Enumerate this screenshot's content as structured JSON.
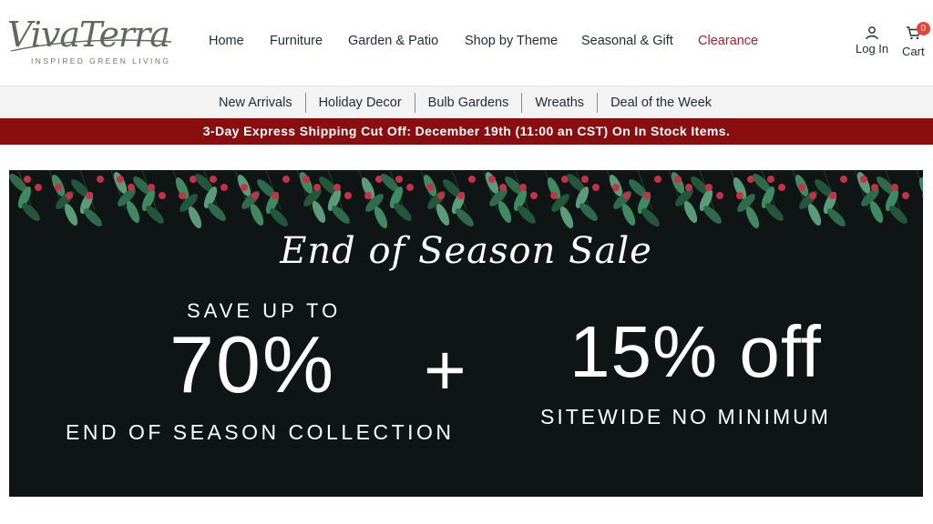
{
  "logo": {
    "wordmark": "VivaTerra",
    "tagline": "INSPIRED GREEN LIVING"
  },
  "main_nav": [
    {
      "label": "Home"
    },
    {
      "label": "Furniture"
    },
    {
      "label": "Garden & Patio"
    },
    {
      "label": "Shop by Theme"
    },
    {
      "label": "Seasonal & Gift"
    },
    {
      "label": "Clearance"
    }
  ],
  "account": {
    "login_label": "Log In",
    "cart_label": "Cart",
    "cart_count": "0"
  },
  "sub_nav": [
    {
      "label": "New Arrivals"
    },
    {
      "label": "Holiday Decor"
    },
    {
      "label": "Bulb Gardens"
    },
    {
      "label": "Wreaths"
    },
    {
      "label": "Deal of the Week"
    }
  ],
  "promo_bar": {
    "text": "3-Day Express Shipping Cut Off: December 19th (11:00 an CST) On In Stock Items."
  },
  "hero": {
    "script_title": "End of Season Sale",
    "save_up_to": "SAVE UP TO",
    "percent_left": "70%",
    "left_caption": "END OF SEASON COLLECTION",
    "plus": "+",
    "percent_right": "15% off",
    "right_caption": "SITEWIDE NO MINIMUM"
  },
  "colors": {
    "clearance": "#a8232b",
    "promo_bar_bg": "#8a0e10",
    "hero_bg": "#0f1414",
    "cart_badge": "#e0463a",
    "subnav_bg": "#f3f3f3",
    "garland_leaf": "#2e6b4c",
    "garland_berry": "#c53145"
  },
  "icons": {
    "user": "user-icon",
    "cart": "cart-icon",
    "garland": "holly-garland-decoration"
  }
}
